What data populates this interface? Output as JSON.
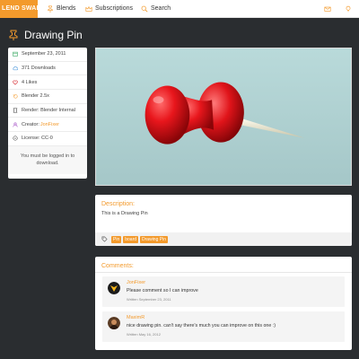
{
  "nav": {
    "brand": "LEND SWAP",
    "items": [
      {
        "label": "Blends",
        "icon": "pin-icon"
      },
      {
        "label": "Subscriptions",
        "icon": "crown-icon"
      },
      {
        "label": "Search",
        "icon": "search-icon"
      }
    ],
    "right_icons": [
      "mail-icon",
      "lightbulb-icon"
    ]
  },
  "page": {
    "title": "Drawing Pin",
    "title_icon": "pin-icon"
  },
  "sidebar": {
    "rows": [
      {
        "icon": "calendar-icon",
        "text": "September 23, 2011"
      },
      {
        "icon": "cloud-download-icon",
        "text": "371 Downloads"
      },
      {
        "icon": "heart-icon",
        "text": "4 Likes"
      },
      {
        "icon": "blender-icon",
        "text": "Blender 2.5x"
      },
      {
        "icon": "render-icon",
        "text": "Render: Blender Internal"
      },
      {
        "icon": "user-icon",
        "label": "Creator: ",
        "link": "JonFixer"
      },
      {
        "icon": "cc-icon",
        "text": "License: CC-0"
      }
    ],
    "login_note": "You must be logged in to download."
  },
  "description": {
    "heading": "Description:",
    "text": "This is a Drawing Pin",
    "tags": [
      "Pin",
      "board",
      "Drawing Pin"
    ]
  },
  "comments": {
    "heading": "Comments:",
    "items": [
      {
        "author": "JonFixer",
        "text": "Please comment so I can improve",
        "date": "Written September 23, 2011"
      },
      {
        "author": "MaximR",
        "text": "nice drawing pin. can't say there's much you can improve on this one :)",
        "date": "Written May 16, 2012"
      }
    ]
  },
  "colors": {
    "accent": "#f39a2c",
    "background": "#2a2d30",
    "pin": "#e8161c"
  }
}
